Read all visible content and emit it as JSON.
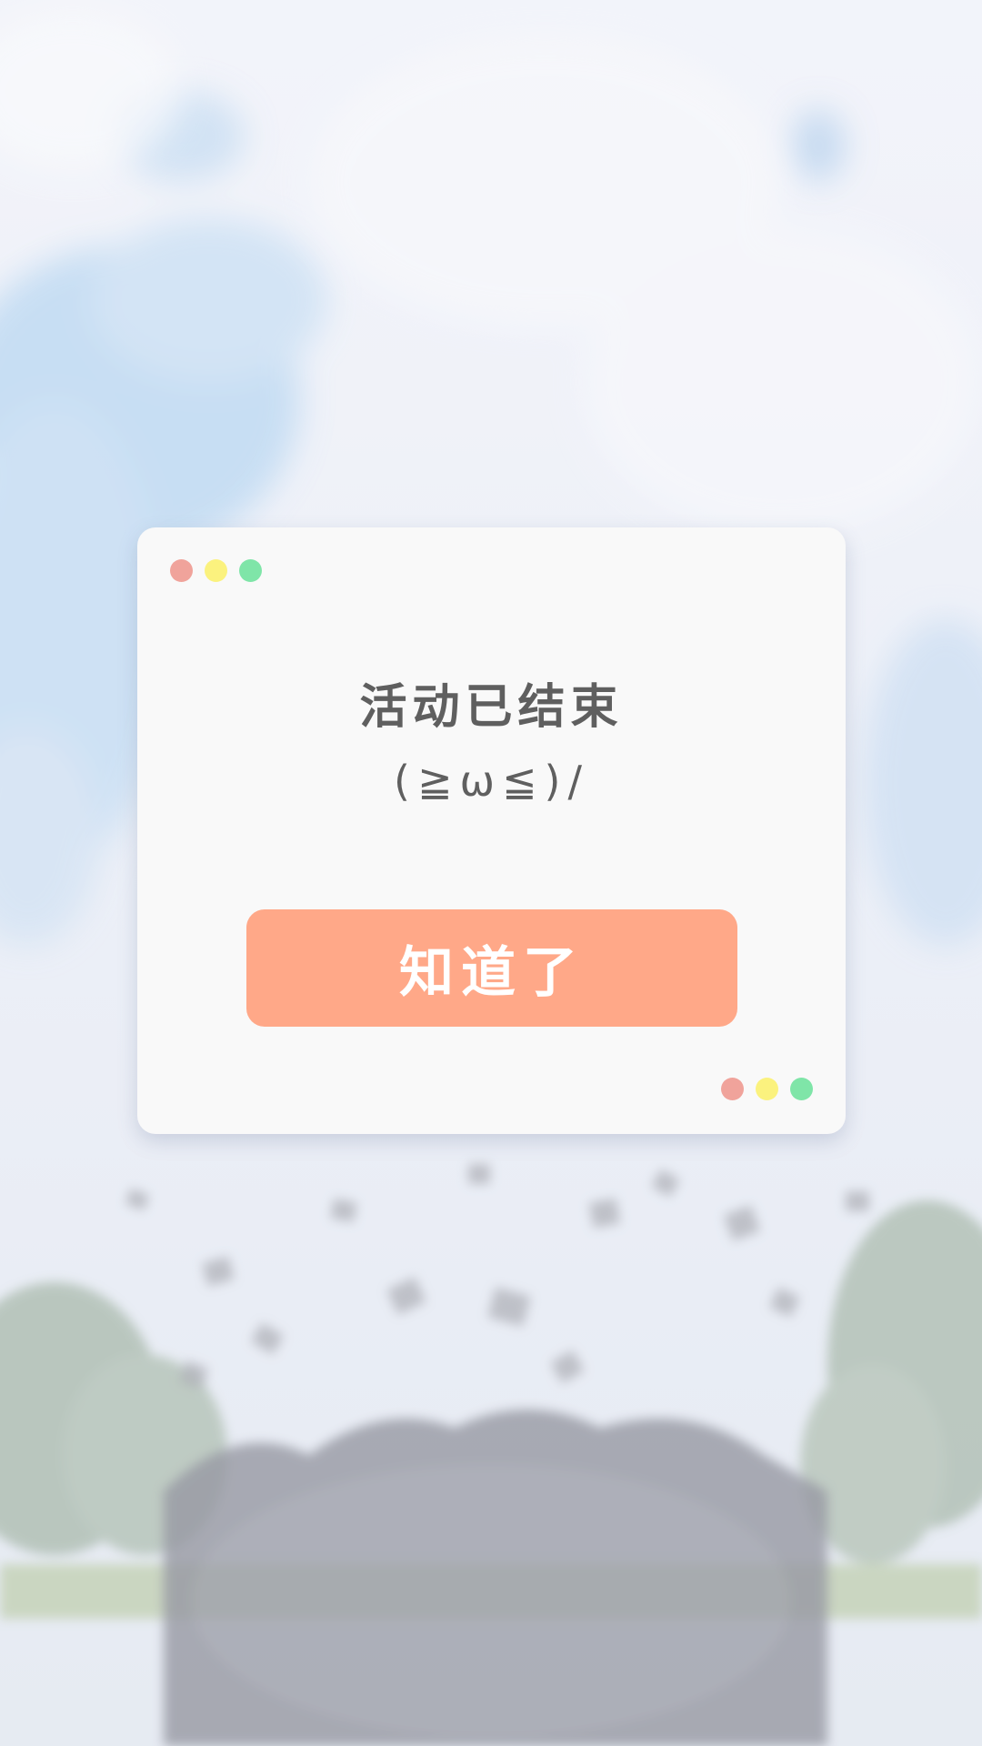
{
  "dialog": {
    "title": "活动已结束",
    "kaomoji": "(≧ω≦)/",
    "confirm_label": "知道了"
  },
  "colors": {
    "dot_red": "#f0a39b",
    "dot_yellow": "#fbf27e",
    "dot_green": "#7fe5a8",
    "button": "#ffa888",
    "card": "#f9f9f9",
    "text": "#5f5f5f"
  },
  "background": {
    "description_icon": "graduation-photo-watercolor"
  }
}
